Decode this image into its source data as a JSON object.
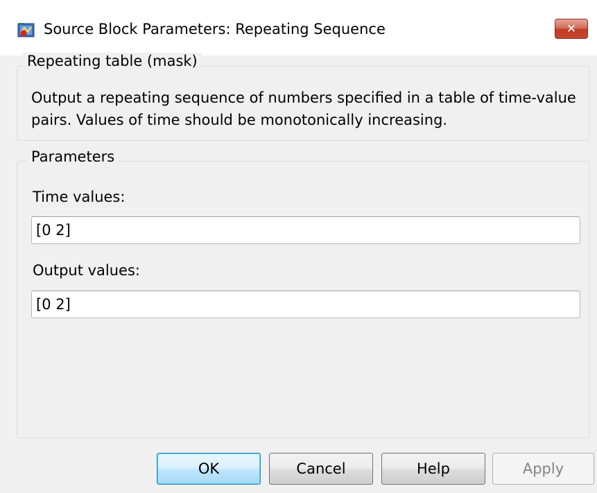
{
  "window": {
    "title": "Source Block Parameters: Repeating Sequence",
    "close_glyph": "✕",
    "icon": "simulink-block-icon"
  },
  "mask_group": {
    "title": "Repeating table (mask)",
    "description": "Output a repeating sequence of numbers specified in a table of time-value pairs. Values of time should be monotonically increasing."
  },
  "params_group": {
    "title": "Parameters",
    "time_label": "Time values:",
    "time_value": "[0 2]",
    "output_label": "Output values:",
    "output_value": "[0 2]"
  },
  "buttons": {
    "ok": "OK",
    "cancel": "Cancel",
    "help": "Help",
    "apply": "Apply"
  },
  "colors": {
    "close_button": "#c4472f",
    "default_button_border": "#3c7fb1",
    "disabled_text": "#838383"
  }
}
